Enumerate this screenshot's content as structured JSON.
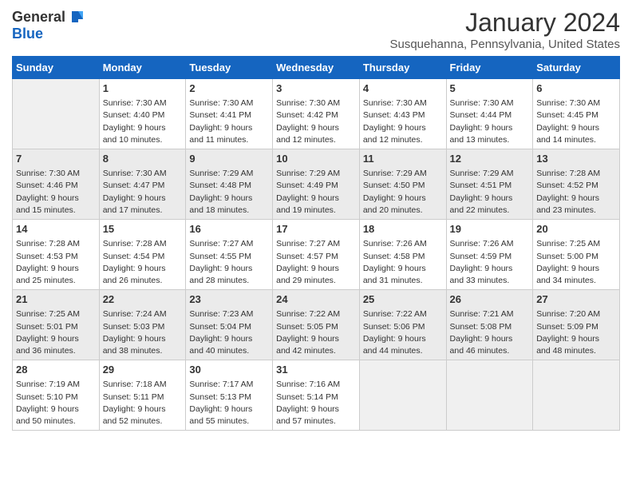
{
  "logo": {
    "general": "General",
    "blue": "Blue"
  },
  "title": "January 2024",
  "subtitle": "Susquehanna, Pennsylvania, United States",
  "days_header": [
    "Sunday",
    "Monday",
    "Tuesday",
    "Wednesday",
    "Thursday",
    "Friday",
    "Saturday"
  ],
  "weeks": [
    [
      {
        "day": "",
        "content": ""
      },
      {
        "day": "1",
        "content": "Sunrise: 7:30 AM\nSunset: 4:40 PM\nDaylight: 9 hours\nand 10 minutes."
      },
      {
        "day": "2",
        "content": "Sunrise: 7:30 AM\nSunset: 4:41 PM\nDaylight: 9 hours\nand 11 minutes."
      },
      {
        "day": "3",
        "content": "Sunrise: 7:30 AM\nSunset: 4:42 PM\nDaylight: 9 hours\nand 12 minutes."
      },
      {
        "day": "4",
        "content": "Sunrise: 7:30 AM\nSunset: 4:43 PM\nDaylight: 9 hours\nand 12 minutes."
      },
      {
        "day": "5",
        "content": "Sunrise: 7:30 AM\nSunset: 4:44 PM\nDaylight: 9 hours\nand 13 minutes."
      },
      {
        "day": "6",
        "content": "Sunrise: 7:30 AM\nSunset: 4:45 PM\nDaylight: 9 hours\nand 14 minutes."
      }
    ],
    [
      {
        "day": "7",
        "content": "Sunrise: 7:30 AM\nSunset: 4:46 PM\nDaylight: 9 hours\nand 15 minutes."
      },
      {
        "day": "8",
        "content": "Sunrise: 7:30 AM\nSunset: 4:47 PM\nDaylight: 9 hours\nand 17 minutes."
      },
      {
        "day": "9",
        "content": "Sunrise: 7:29 AM\nSunset: 4:48 PM\nDaylight: 9 hours\nand 18 minutes."
      },
      {
        "day": "10",
        "content": "Sunrise: 7:29 AM\nSunset: 4:49 PM\nDaylight: 9 hours\nand 19 minutes."
      },
      {
        "day": "11",
        "content": "Sunrise: 7:29 AM\nSunset: 4:50 PM\nDaylight: 9 hours\nand 20 minutes."
      },
      {
        "day": "12",
        "content": "Sunrise: 7:29 AM\nSunset: 4:51 PM\nDaylight: 9 hours\nand 22 minutes."
      },
      {
        "day": "13",
        "content": "Sunrise: 7:28 AM\nSunset: 4:52 PM\nDaylight: 9 hours\nand 23 minutes."
      }
    ],
    [
      {
        "day": "14",
        "content": "Sunrise: 7:28 AM\nSunset: 4:53 PM\nDaylight: 9 hours\nand 25 minutes."
      },
      {
        "day": "15",
        "content": "Sunrise: 7:28 AM\nSunset: 4:54 PM\nDaylight: 9 hours\nand 26 minutes."
      },
      {
        "day": "16",
        "content": "Sunrise: 7:27 AM\nSunset: 4:55 PM\nDaylight: 9 hours\nand 28 minutes."
      },
      {
        "day": "17",
        "content": "Sunrise: 7:27 AM\nSunset: 4:57 PM\nDaylight: 9 hours\nand 29 minutes."
      },
      {
        "day": "18",
        "content": "Sunrise: 7:26 AM\nSunset: 4:58 PM\nDaylight: 9 hours\nand 31 minutes."
      },
      {
        "day": "19",
        "content": "Sunrise: 7:26 AM\nSunset: 4:59 PM\nDaylight: 9 hours\nand 33 minutes."
      },
      {
        "day": "20",
        "content": "Sunrise: 7:25 AM\nSunset: 5:00 PM\nDaylight: 9 hours\nand 34 minutes."
      }
    ],
    [
      {
        "day": "21",
        "content": "Sunrise: 7:25 AM\nSunset: 5:01 PM\nDaylight: 9 hours\nand 36 minutes."
      },
      {
        "day": "22",
        "content": "Sunrise: 7:24 AM\nSunset: 5:03 PM\nDaylight: 9 hours\nand 38 minutes."
      },
      {
        "day": "23",
        "content": "Sunrise: 7:23 AM\nSunset: 5:04 PM\nDaylight: 9 hours\nand 40 minutes."
      },
      {
        "day": "24",
        "content": "Sunrise: 7:22 AM\nSunset: 5:05 PM\nDaylight: 9 hours\nand 42 minutes."
      },
      {
        "day": "25",
        "content": "Sunrise: 7:22 AM\nSunset: 5:06 PM\nDaylight: 9 hours\nand 44 minutes."
      },
      {
        "day": "26",
        "content": "Sunrise: 7:21 AM\nSunset: 5:08 PM\nDaylight: 9 hours\nand 46 minutes."
      },
      {
        "day": "27",
        "content": "Sunrise: 7:20 AM\nSunset: 5:09 PM\nDaylight: 9 hours\nand 48 minutes."
      }
    ],
    [
      {
        "day": "28",
        "content": "Sunrise: 7:19 AM\nSunset: 5:10 PM\nDaylight: 9 hours\nand 50 minutes."
      },
      {
        "day": "29",
        "content": "Sunrise: 7:18 AM\nSunset: 5:11 PM\nDaylight: 9 hours\nand 52 minutes."
      },
      {
        "day": "30",
        "content": "Sunrise: 7:17 AM\nSunset: 5:13 PM\nDaylight: 9 hours\nand 55 minutes."
      },
      {
        "day": "31",
        "content": "Sunrise: 7:16 AM\nSunset: 5:14 PM\nDaylight: 9 hours\nand 57 minutes."
      },
      {
        "day": "",
        "content": ""
      },
      {
        "day": "",
        "content": ""
      },
      {
        "day": "",
        "content": ""
      }
    ]
  ]
}
